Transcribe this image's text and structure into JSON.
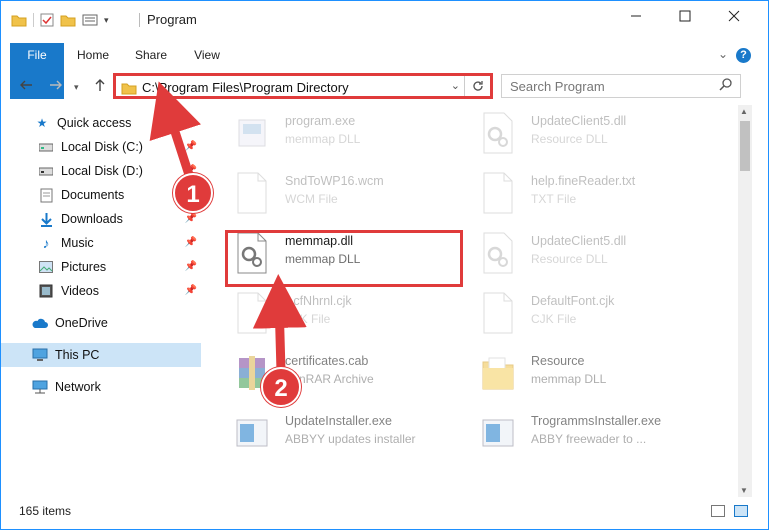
{
  "window": {
    "title": "Program"
  },
  "ribbon": {
    "tabs": [
      "File",
      "Home",
      "Share",
      "View"
    ]
  },
  "address": {
    "path": "C:\\Program Files\\Program Directory"
  },
  "search": {
    "placeholder": "Search Program"
  },
  "sidebar": {
    "items": [
      {
        "label": "Quick access",
        "icon": "star-icon"
      },
      {
        "label": "Local Disk (C:)",
        "icon": "drive-icon",
        "pinned": true
      },
      {
        "label": "Local Disk (D:)",
        "icon": "drive-icon",
        "pinned": true
      },
      {
        "label": "Documents",
        "icon": "documents-icon",
        "pinned": true
      },
      {
        "label": "Downloads",
        "icon": "download-icon",
        "pinned": true
      },
      {
        "label": "Music",
        "icon": "music-icon",
        "pinned": true
      },
      {
        "label": "Pictures",
        "icon": "pictures-icon",
        "pinned": true
      },
      {
        "label": "Videos",
        "icon": "videos-icon",
        "pinned": true
      },
      {
        "label": "OneDrive",
        "icon": "cloud-icon"
      },
      {
        "label": "This PC",
        "icon": "computer-icon",
        "selected": true
      },
      {
        "label": "Network",
        "icon": "network-icon"
      }
    ]
  },
  "files": [
    {
      "name": "program.exe",
      "type": "memmap DLL",
      "icon": "program-icon"
    },
    {
      "name": "UpdateClient5.dll",
      "type": "Resource DLL",
      "icon": "dll-gear-icon"
    },
    {
      "name": "SndToWP16.wcm",
      "type": "WCM File",
      "icon": "blank-file-icon"
    },
    {
      "name": "help.fineReader.txt",
      "type": "TXT File",
      "icon": "blank-file-icon"
    },
    {
      "name": "memmap.dll",
      "type": "memmap DLL",
      "icon": "dll-gear-icon"
    },
    {
      "name": "UpdateClient5.dll",
      "type": "Resource DLL",
      "icon": "dll-gear-icon"
    },
    {
      "name": "AcfNhrnl.cjk",
      "type": "CJK File",
      "icon": "blank-file-icon"
    },
    {
      "name": "DefaultFont.cjk",
      "type": "CJK File",
      "icon": "blank-file-icon"
    },
    {
      "name": "certificates.cab",
      "type": "WinRAR Archive",
      "icon": "winrar-icon"
    },
    {
      "name": "Resource",
      "type": "memmap DLL",
      "icon": "folder-icon"
    },
    {
      "name": "UpdateInstaller.exe",
      "type": "ABBYY updates installer",
      "icon": "installer-icon"
    },
    {
      "name": "TrogrammsInstaller.exe",
      "type": "ABBY freewader to ...",
      "icon": "installer-icon"
    }
  ],
  "status": {
    "count": "165 items"
  },
  "annotations": [
    "1",
    "2"
  ],
  "colors": {
    "accent": "#1979ca",
    "highlight": "#e03b3b"
  }
}
